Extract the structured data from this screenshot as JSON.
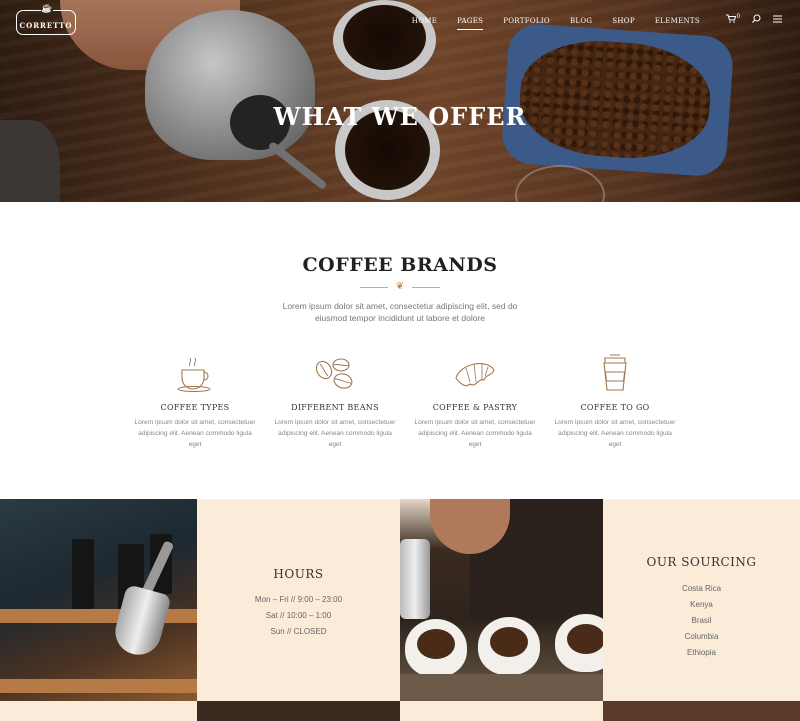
{
  "brand": {
    "name": "CORRETTO"
  },
  "nav": {
    "items": [
      {
        "label": "HOME",
        "active": false
      },
      {
        "label": "PAGES",
        "active": true
      },
      {
        "label": "PORTFOLIO",
        "active": false
      },
      {
        "label": "BLOG",
        "active": false
      },
      {
        "label": "SHOP",
        "active": false
      },
      {
        "label": "ELEMENTS",
        "active": false
      }
    ],
    "cart_count": "0",
    "icons": [
      "cart-icon",
      "search-icon",
      "menu-icon"
    ]
  },
  "hero": {
    "title": "WHAT WE OFFER"
  },
  "brands": {
    "title": "COFFEE BRANDS",
    "intro": "Lorem ipsum dolor sit amet, consectetur adipiscing elit, sed do eiusmod tempor incididunt ut labore et dolore",
    "features": [
      {
        "title": "COFFEE TYPES",
        "text": "Lorem ipsum dolor sit amet, consectetuer adipiscing elit. Aenean commodo ligula eget",
        "icon": "coffee-cup-icon"
      },
      {
        "title": "DIFFERENT BEANS",
        "text": "Lorem ipsum dolor sit amet, consectetuer adipiscing elit. Aenean commodo ligula eget",
        "icon": "coffee-beans-icon"
      },
      {
        "title": "COFFEE & PASTRY",
        "text": "Lorem ipsum dolor sit amet, consectetuer adipiscing elit. Aenean commodo ligula eget",
        "icon": "croissant-icon"
      },
      {
        "title": "COFFEE TO GO",
        "text": "Lorem ipsum dolor sit amet, consectetuer adipiscing elit. Aenean commodo ligula eget",
        "icon": "takeaway-cup-icon"
      }
    ]
  },
  "hours": {
    "title": "HOURS",
    "lines": [
      "Mon – Fri // 9:00 – 23:00",
      "Sat // 10:00 – 1:00",
      "Sun // CLOSED"
    ]
  },
  "sourcing": {
    "title": "OUR SOURCING",
    "items": [
      "Costa Rica",
      "Kenya",
      "Brasil",
      "Columbia",
      "Ethiopia"
    ]
  },
  "colors": {
    "accent": "#b98a5f",
    "cream": "#fbecd9"
  }
}
